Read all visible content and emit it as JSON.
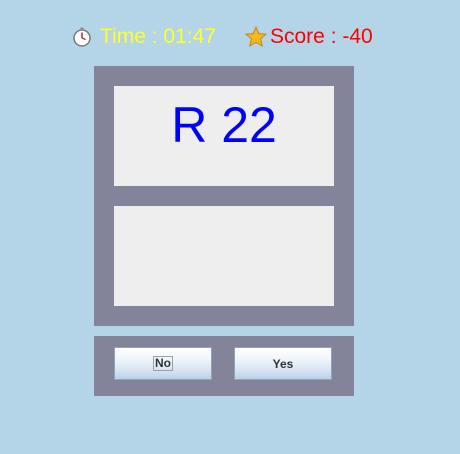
{
  "hud": {
    "timer_icon": "stopwatch-icon",
    "time_text": "Time : 01:47",
    "score_icon": "star-icon",
    "score_text": "Score : -40"
  },
  "board": {
    "top_card_text": "R 22",
    "bottom_card_text": ""
  },
  "controls": {
    "no_label": "No",
    "yes_label": "Yes"
  },
  "colors": {
    "background": "#b4d4e7",
    "panel": "#83849a",
    "card": "#eeeeee",
    "time_text": "#ffff2a",
    "score_text": "#ff0000",
    "card_text": "#0000ff"
  }
}
